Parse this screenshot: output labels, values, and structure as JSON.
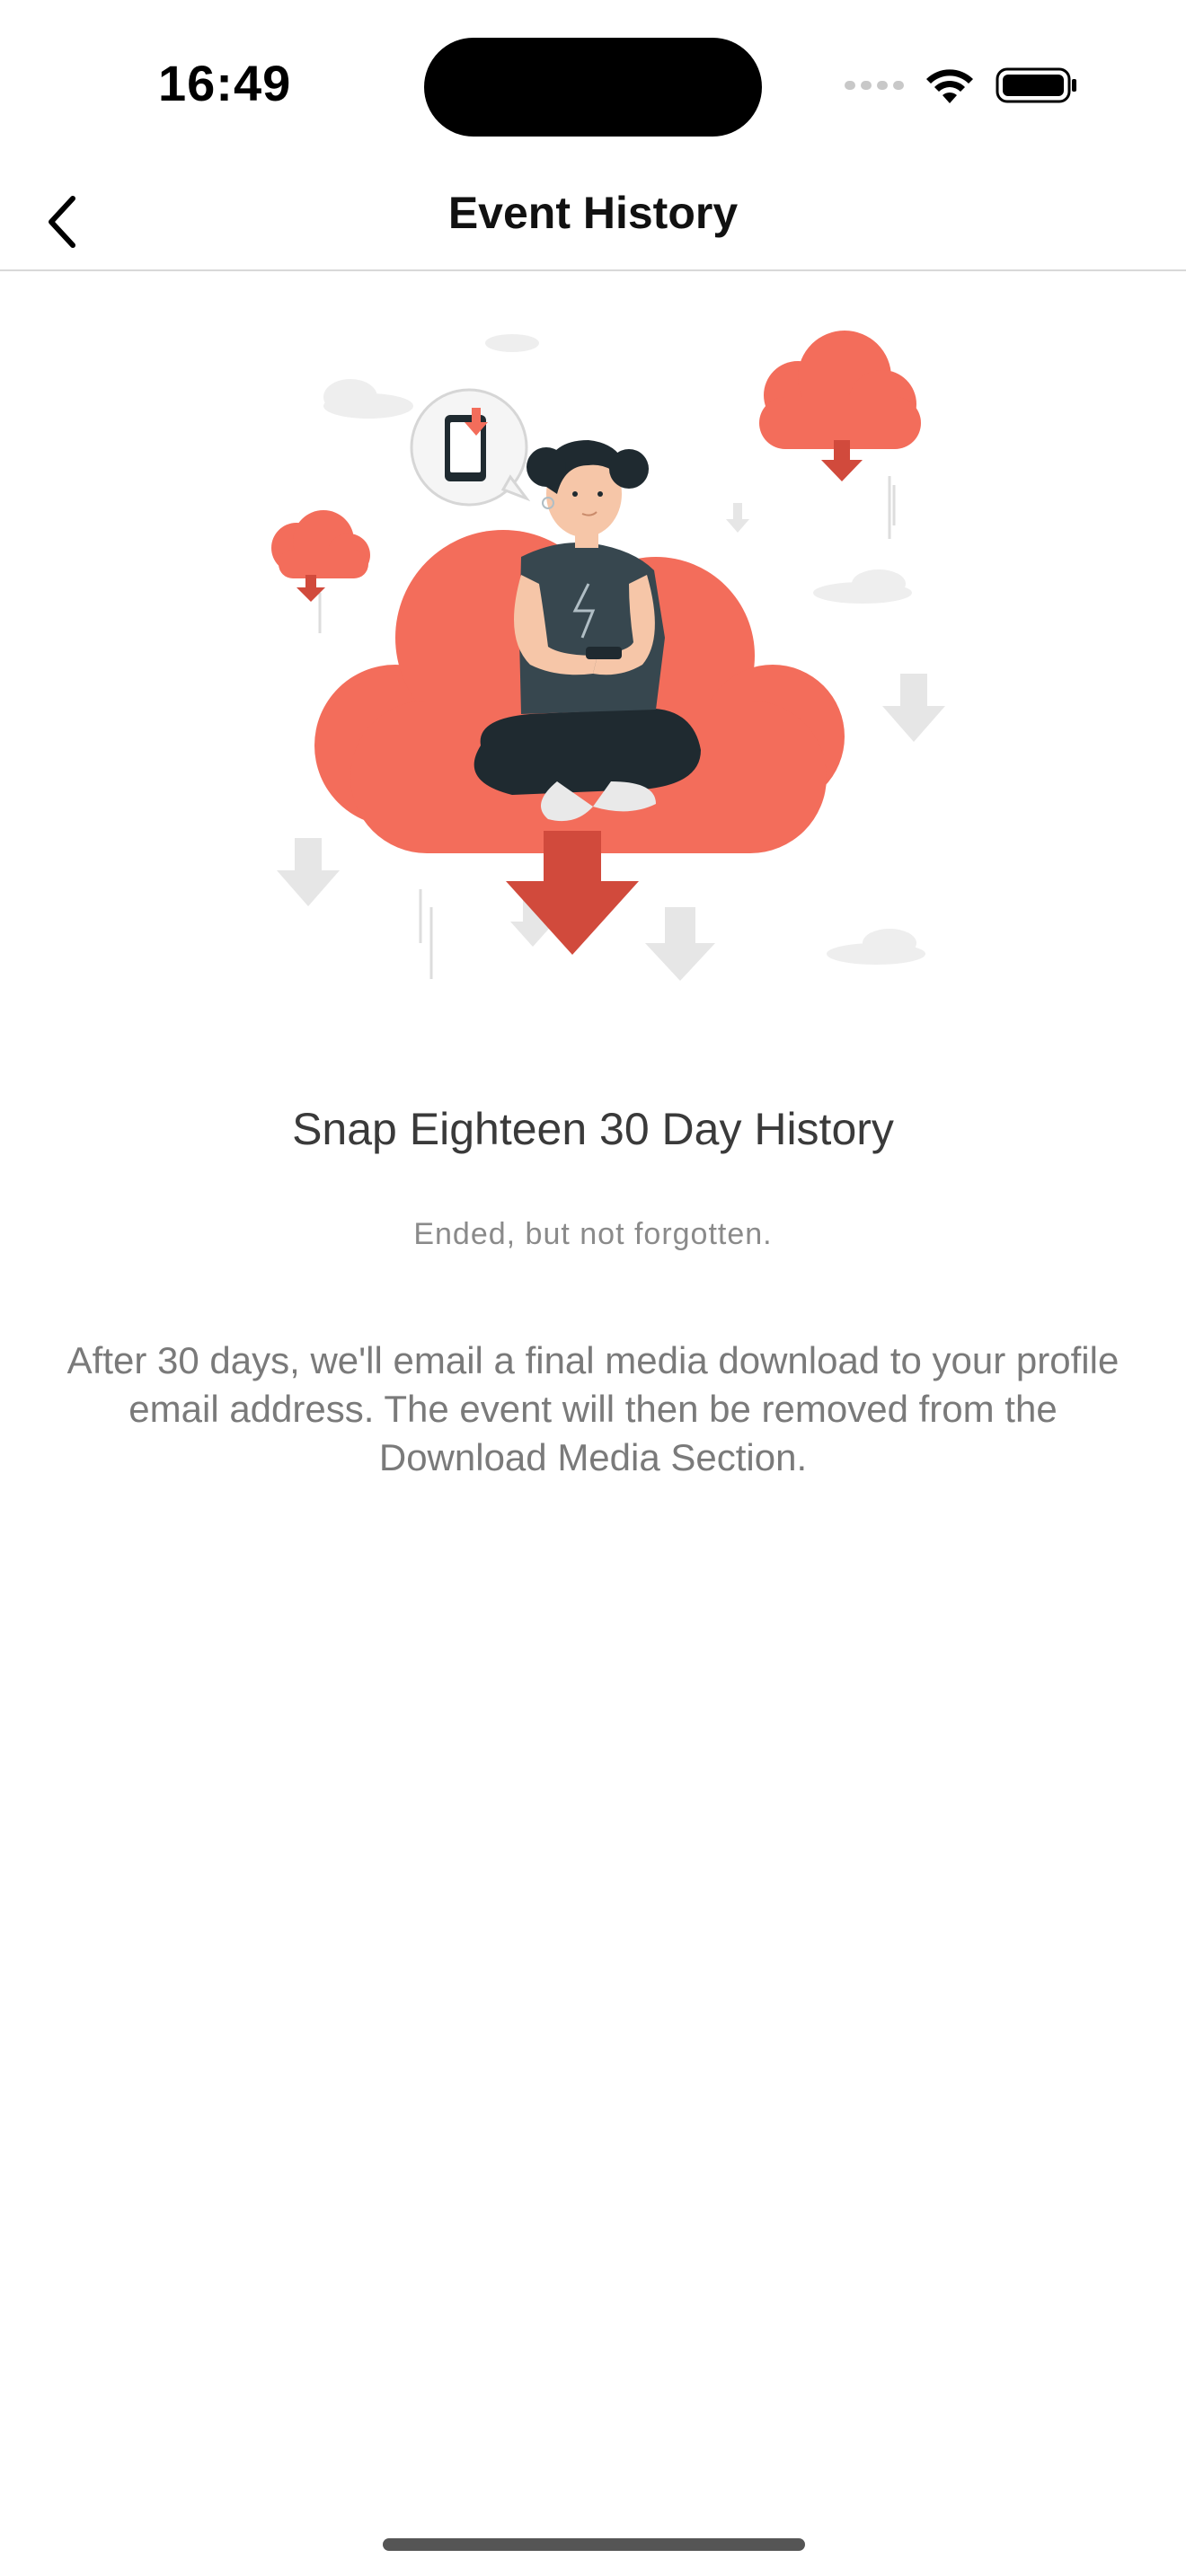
{
  "status_bar": {
    "time": "16:49"
  },
  "nav": {
    "title": "Event History",
    "back_icon": "chevron-left-icon"
  },
  "illustration": {
    "description_icon": "cloud-download-illustration",
    "colors": {
      "accent": "#F36D5B",
      "accent_dark": "#D14A3C",
      "hair": "#1F2A30",
      "shirt": "#37474F",
      "skin": "#F6C6A8",
      "grey": "#E9E9E9"
    }
  },
  "content": {
    "title": "Snap Eighteen 30 Day History",
    "subtitle": "Ended, but not forgotten.",
    "description": "After 30 days, we'll email a final media download to your profile email address. The event will then be removed from the Download Media Section."
  }
}
